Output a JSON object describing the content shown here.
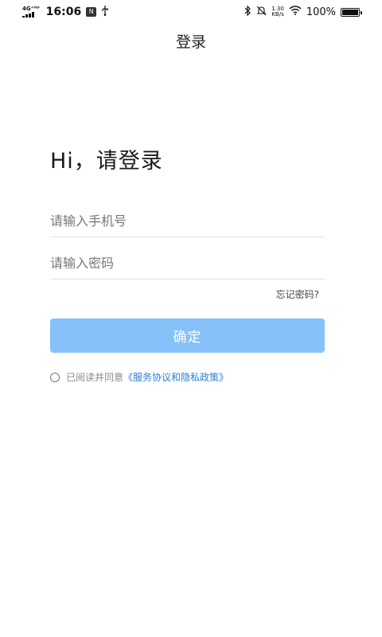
{
  "status_bar": {
    "network": "4G⁺ᴴᴰ",
    "time": "16:06",
    "badge": "N",
    "usb_icon": "usb-icon",
    "speed_value": "1.30",
    "speed_unit": "KB/s",
    "battery": "100%"
  },
  "header": {
    "title": "登录"
  },
  "login": {
    "greeting": "Hi，请登录",
    "phone_placeholder": "请输入手机号",
    "phone_value": "",
    "password_placeholder": "请输入密码",
    "password_value": "",
    "forgot_label": "忘记密码?",
    "confirm_label": "确定",
    "agreement_text": "已阅读并同意",
    "agreement_link": "《服务协议和隐私政策》"
  },
  "colors": {
    "button_bg": "#86c1fa",
    "link": "#2a7fd6"
  }
}
